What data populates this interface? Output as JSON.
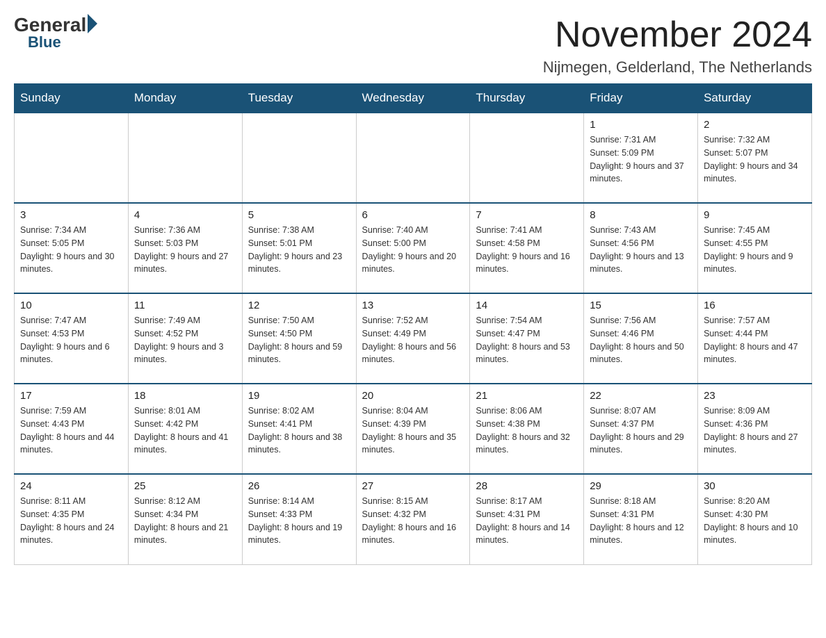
{
  "logo": {
    "general": "General",
    "blue": "Blue"
  },
  "title": {
    "month": "November 2024",
    "location": "Nijmegen, Gelderland, The Netherlands"
  },
  "weekdays": [
    "Sunday",
    "Monday",
    "Tuesday",
    "Wednesday",
    "Thursday",
    "Friday",
    "Saturday"
  ],
  "weeks": [
    [
      {
        "day": "",
        "info": ""
      },
      {
        "day": "",
        "info": ""
      },
      {
        "day": "",
        "info": ""
      },
      {
        "day": "",
        "info": ""
      },
      {
        "day": "",
        "info": ""
      },
      {
        "day": "1",
        "info": "Sunrise: 7:31 AM\nSunset: 5:09 PM\nDaylight: 9 hours and 37 minutes."
      },
      {
        "day": "2",
        "info": "Sunrise: 7:32 AM\nSunset: 5:07 PM\nDaylight: 9 hours and 34 minutes."
      }
    ],
    [
      {
        "day": "3",
        "info": "Sunrise: 7:34 AM\nSunset: 5:05 PM\nDaylight: 9 hours and 30 minutes."
      },
      {
        "day": "4",
        "info": "Sunrise: 7:36 AM\nSunset: 5:03 PM\nDaylight: 9 hours and 27 minutes."
      },
      {
        "day": "5",
        "info": "Sunrise: 7:38 AM\nSunset: 5:01 PM\nDaylight: 9 hours and 23 minutes."
      },
      {
        "day": "6",
        "info": "Sunrise: 7:40 AM\nSunset: 5:00 PM\nDaylight: 9 hours and 20 minutes."
      },
      {
        "day": "7",
        "info": "Sunrise: 7:41 AM\nSunset: 4:58 PM\nDaylight: 9 hours and 16 minutes."
      },
      {
        "day": "8",
        "info": "Sunrise: 7:43 AM\nSunset: 4:56 PM\nDaylight: 9 hours and 13 minutes."
      },
      {
        "day": "9",
        "info": "Sunrise: 7:45 AM\nSunset: 4:55 PM\nDaylight: 9 hours and 9 minutes."
      }
    ],
    [
      {
        "day": "10",
        "info": "Sunrise: 7:47 AM\nSunset: 4:53 PM\nDaylight: 9 hours and 6 minutes."
      },
      {
        "day": "11",
        "info": "Sunrise: 7:49 AM\nSunset: 4:52 PM\nDaylight: 9 hours and 3 minutes."
      },
      {
        "day": "12",
        "info": "Sunrise: 7:50 AM\nSunset: 4:50 PM\nDaylight: 8 hours and 59 minutes."
      },
      {
        "day": "13",
        "info": "Sunrise: 7:52 AM\nSunset: 4:49 PM\nDaylight: 8 hours and 56 minutes."
      },
      {
        "day": "14",
        "info": "Sunrise: 7:54 AM\nSunset: 4:47 PM\nDaylight: 8 hours and 53 minutes."
      },
      {
        "day": "15",
        "info": "Sunrise: 7:56 AM\nSunset: 4:46 PM\nDaylight: 8 hours and 50 minutes."
      },
      {
        "day": "16",
        "info": "Sunrise: 7:57 AM\nSunset: 4:44 PM\nDaylight: 8 hours and 47 minutes."
      }
    ],
    [
      {
        "day": "17",
        "info": "Sunrise: 7:59 AM\nSunset: 4:43 PM\nDaylight: 8 hours and 44 minutes."
      },
      {
        "day": "18",
        "info": "Sunrise: 8:01 AM\nSunset: 4:42 PM\nDaylight: 8 hours and 41 minutes."
      },
      {
        "day": "19",
        "info": "Sunrise: 8:02 AM\nSunset: 4:41 PM\nDaylight: 8 hours and 38 minutes."
      },
      {
        "day": "20",
        "info": "Sunrise: 8:04 AM\nSunset: 4:39 PM\nDaylight: 8 hours and 35 minutes."
      },
      {
        "day": "21",
        "info": "Sunrise: 8:06 AM\nSunset: 4:38 PM\nDaylight: 8 hours and 32 minutes."
      },
      {
        "day": "22",
        "info": "Sunrise: 8:07 AM\nSunset: 4:37 PM\nDaylight: 8 hours and 29 minutes."
      },
      {
        "day": "23",
        "info": "Sunrise: 8:09 AM\nSunset: 4:36 PM\nDaylight: 8 hours and 27 minutes."
      }
    ],
    [
      {
        "day": "24",
        "info": "Sunrise: 8:11 AM\nSunset: 4:35 PM\nDaylight: 8 hours and 24 minutes."
      },
      {
        "day": "25",
        "info": "Sunrise: 8:12 AM\nSunset: 4:34 PM\nDaylight: 8 hours and 21 minutes."
      },
      {
        "day": "26",
        "info": "Sunrise: 8:14 AM\nSunset: 4:33 PM\nDaylight: 8 hours and 19 minutes."
      },
      {
        "day": "27",
        "info": "Sunrise: 8:15 AM\nSunset: 4:32 PM\nDaylight: 8 hours and 16 minutes."
      },
      {
        "day": "28",
        "info": "Sunrise: 8:17 AM\nSunset: 4:31 PM\nDaylight: 8 hours and 14 minutes."
      },
      {
        "day": "29",
        "info": "Sunrise: 8:18 AM\nSunset: 4:31 PM\nDaylight: 8 hours and 12 minutes."
      },
      {
        "day": "30",
        "info": "Sunrise: 8:20 AM\nSunset: 4:30 PM\nDaylight: 8 hours and 10 minutes."
      }
    ]
  ]
}
